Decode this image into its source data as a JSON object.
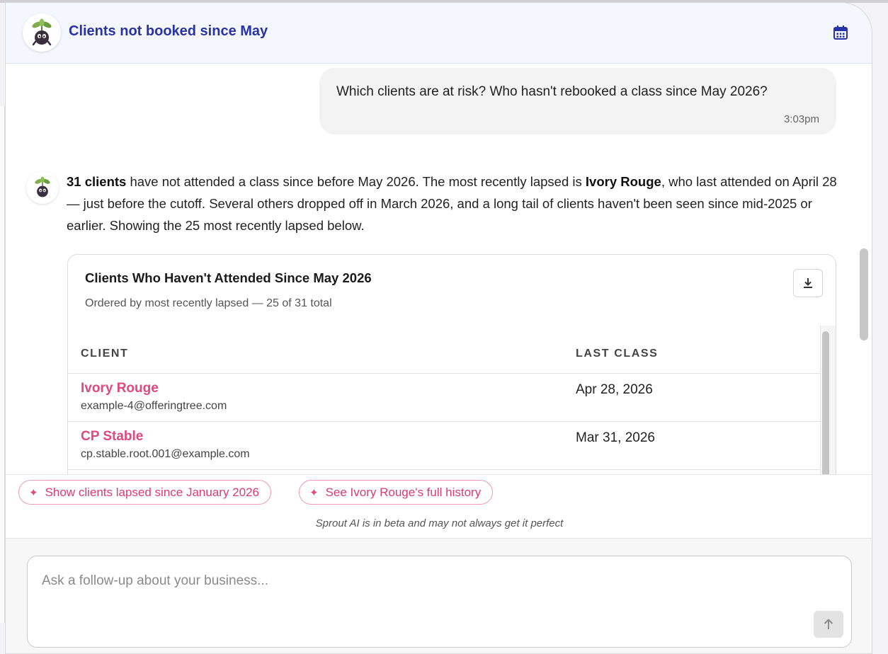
{
  "header": {
    "title": "Clients not booked since May",
    "calendar_icon": "calendar-icon"
  },
  "user_message": {
    "text": "Which clients are at risk? Who hasn't rebooked a class since May 2026?",
    "time": "3:03pm"
  },
  "assistant": {
    "intro_bold": "31 clients",
    "intro_1": " have not attended a class since before May 2026. The most recently lapsed is ",
    "name_bold": "Ivory Rouge",
    "intro_2": ", who last attended on April 28 — just before the cutoff. Several others dropped off in March 2026, and a long tail of clients haven't been seen since mid-2025 or earlier. Showing the 25 most recently lapsed below."
  },
  "card": {
    "title": "Clients Who Haven't Attended Since May 2026",
    "subtitle": "Ordered by most recently lapsed — 25 of 31 total",
    "download_icon": "download-icon",
    "columns": [
      "CLIENT",
      "LAST CLASS"
    ],
    "rows": [
      {
        "name": "Ivory Rouge",
        "email": "example-4@offeringtree.com",
        "last_class": "Apr 28, 2026"
      },
      {
        "name": "CP Stable",
        "email": "cp.stable.root.001@example.com",
        "last_class": "Mar 31, 2026"
      }
    ]
  },
  "suggestions": [
    {
      "label": "Show clients lapsed since January 2026",
      "icon": "sparkle-icon"
    },
    {
      "label": "See Ivory Rouge's full history",
      "icon": "sparkle-icon"
    }
  ],
  "disclaimer": "Sprout AI is in beta and may not always get it perfect",
  "composer": {
    "placeholder": "Ask a follow-up about your business...",
    "send_icon": "arrow-up-icon"
  },
  "colors": {
    "title_blue": "#2a32a8",
    "accent_pink": "#e0487e"
  }
}
